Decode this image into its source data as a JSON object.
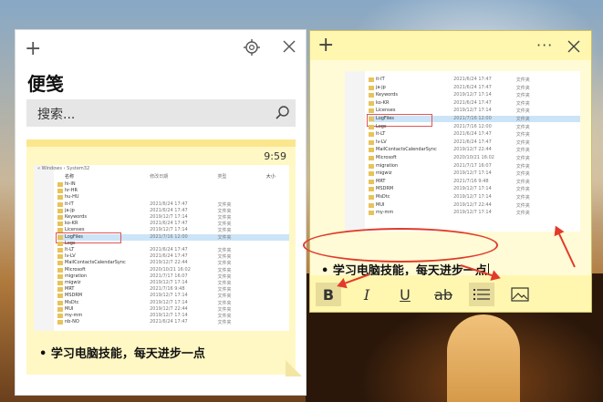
{
  "app": {
    "title": "便笺"
  },
  "search": {
    "placeholder": "搜索..."
  },
  "note_list": [
    {
      "time": "9:59",
      "text": "• 学习电脑技能，每天进步一点"
    }
  ],
  "editor": {
    "text": "• 学习电脑技能，每天进步一点",
    "toolbar": {
      "bold": "B",
      "italic": "I",
      "underline": "U",
      "strike": "ab"
    }
  },
  "explorer_left": {
    "crumb": "« Windows › System32",
    "headers": [
      "名称",
      "修改日期",
      "类型",
      "大小"
    ],
    "rows": [
      {
        "name": "hi-IN",
        "date": "",
        "type": ""
      },
      {
        "name": "hr-HR",
        "date": "",
        "type": ""
      },
      {
        "name": "hu-HU",
        "date": "",
        "type": ""
      },
      {
        "name": "it-IT",
        "date": "2021/6/24 17:47",
        "type": "文件夹"
      },
      {
        "name": "ja-jp",
        "date": "2021/6/24 17:47",
        "type": "文件夹"
      },
      {
        "name": "Keywords",
        "date": "2019/12/7 17:14",
        "type": "文件夹"
      },
      {
        "name": "ko-KR",
        "date": "2021/6/24 17:47",
        "type": "文件夹"
      },
      {
        "name": "Licenses",
        "date": "2019/12/7 17:14",
        "type": "文件夹"
      },
      {
        "name": "LogFiles",
        "date": "2021/7/16 12:00",
        "type": "文件夹"
      },
      {
        "name": "Logs",
        "date": "",
        "type": ""
      },
      {
        "name": "lt-LT",
        "date": "2021/6/24 17:47",
        "type": "文件夹"
      },
      {
        "name": "lv-LV",
        "date": "2021/6/24 17:47",
        "type": "文件夹"
      },
      {
        "name": "MailContactsCalendarSync",
        "date": "2019/12/7 22:44",
        "type": "文件夹"
      },
      {
        "name": "Microsoft",
        "date": "2020/10/21 16:02",
        "type": "文件夹"
      },
      {
        "name": "migration",
        "date": "2021/7/17 16:07",
        "type": "文件夹"
      },
      {
        "name": "migwiz",
        "date": "2019/12/7 17:14",
        "type": "文件夹"
      },
      {
        "name": "MRT",
        "date": "2021/7/16 9:48",
        "type": "文件夹"
      },
      {
        "name": "MSDRM",
        "date": "2019/12/7 17:14",
        "type": "文件夹"
      },
      {
        "name": "MsDtc",
        "date": "2019/12/7 17:14",
        "type": "文件夹"
      },
      {
        "name": "MUI",
        "date": "2019/12/7 22:44",
        "type": "文件夹"
      },
      {
        "name": "my-mm",
        "date": "2019/12/7 17:14",
        "type": "文件夹"
      },
      {
        "name": "nb-NO",
        "date": "2021/6/24 17:47",
        "type": "文件夹"
      }
    ]
  },
  "explorer_right": {
    "rows": [
      {
        "name": "it-IT",
        "date": "2021/6/24 17:47",
        "type": "文件夹"
      },
      {
        "name": "ja-jp",
        "date": "2021/6/24 17:47",
        "type": "文件夹"
      },
      {
        "name": "Keywords",
        "date": "2019/12/7 17:14",
        "type": "文件夹"
      },
      {
        "name": "ko-KR",
        "date": "2021/6/24 17:47",
        "type": "文件夹"
      },
      {
        "name": "Licenses",
        "date": "2019/12/7 17:14",
        "type": "文件夹"
      },
      {
        "name": "LogFiles",
        "date": "2021/7/16 12:00",
        "type": "文件夹"
      },
      {
        "name": "Logs",
        "date": "2021/7/16 12:00",
        "type": "文件夹"
      },
      {
        "name": "lt-LT",
        "date": "2021/6/24 17:47",
        "type": "文件夹"
      },
      {
        "name": "lv-LV",
        "date": "2021/6/24 17:47",
        "type": "文件夹"
      },
      {
        "name": "MailContactsCalendarSync",
        "date": "2019/12/7 22:44",
        "type": "文件夹"
      },
      {
        "name": "Microsoft",
        "date": "2020/10/21 16:02",
        "type": "文件夹"
      },
      {
        "name": "migration",
        "date": "2021/7/17 16:07",
        "type": "文件夹"
      },
      {
        "name": "migwiz",
        "date": "2019/12/7 17:14",
        "type": "文件夹"
      },
      {
        "name": "MRT",
        "date": "2021/7/16 9:48",
        "type": "文件夹"
      },
      {
        "name": "MSDRM",
        "date": "2019/12/7 17:14",
        "type": "文件夹"
      },
      {
        "name": "MsDtc",
        "date": "2019/12/7 17:14",
        "type": "文件夹"
      },
      {
        "name": "MUI",
        "date": "2019/12/7 22:44",
        "type": "文件夹"
      },
      {
        "name": "my-mm",
        "date": "2019/12/7 17:14",
        "type": "文件夹"
      }
    ]
  },
  "colors": {
    "note_bg": "#fff7b0",
    "accent_red": "#e23a2a"
  }
}
